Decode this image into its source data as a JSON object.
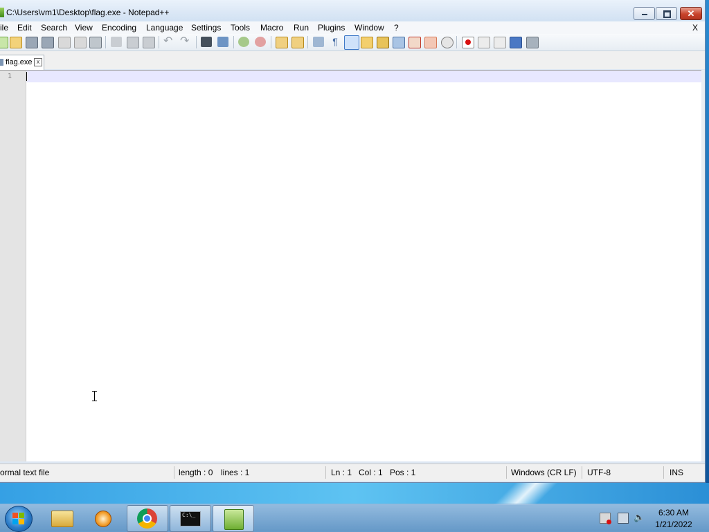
{
  "window": {
    "title": "C:\\Users\\vm1\\Desktop\\flag.exe - Notepad++",
    "close_glyph": "✕"
  },
  "menu": {
    "items": [
      "ile",
      "Edit",
      "Search",
      "View",
      "Encoding",
      "Language",
      "Settings",
      "Tools",
      "Macro",
      "Run",
      "Plugins",
      "Window",
      "?"
    ],
    "close_doc": "X"
  },
  "toolbar": {
    "icons": [
      "new-file-icon",
      "open-file-icon",
      "save-icon",
      "save-all-icon",
      "close-icon",
      "close-all-icon",
      "print-icon",
      "cut-icon",
      "copy-icon",
      "paste-icon",
      "undo-icon",
      "redo-icon",
      "find-icon",
      "replace-icon",
      "zoom-in-icon",
      "zoom-out-icon",
      "sync-vertical-icon",
      "sync-horizontal-icon",
      "word-wrap-icon",
      "show-all-chars-icon",
      "indent-guide-icon",
      "user-defined-lang-icon",
      "doc-map-icon",
      "function-list-icon",
      "folder-as-workspace-icon",
      "doc-list-icon",
      "monitoring-icon",
      "record-macro-icon",
      "stop-record-icon",
      "play-macro-icon",
      "run-macro-multiple-icon",
      "save-macro-icon"
    ]
  },
  "tab": {
    "label": "flag.exe",
    "close_glyph": "x"
  },
  "editor": {
    "line_numbers": [
      "1"
    ],
    "content": ""
  },
  "status": {
    "file_type": "ormal text file",
    "length": "length : 0",
    "lines": "lines : 1",
    "ln": "Ln : 1",
    "col": "Col : 1",
    "pos": "Pos : 1",
    "eol": "Windows (CR LF)",
    "encoding": "UTF-8",
    "mode": "INS"
  },
  "taskbar": {
    "apps": [
      "explorer",
      "media-player",
      "chrome",
      "command-prompt",
      "notepad-plus-plus"
    ],
    "time": "6:30 AM",
    "date": "1/21/2022"
  }
}
